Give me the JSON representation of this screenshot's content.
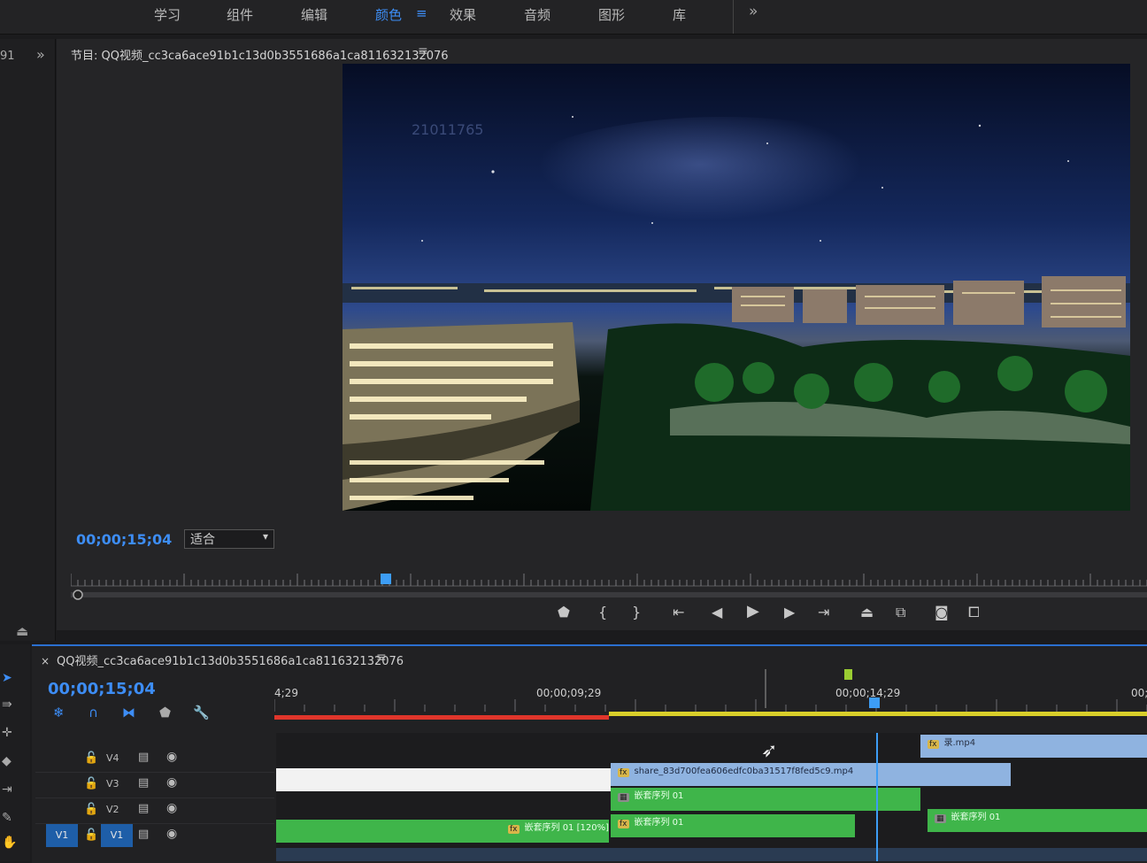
{
  "workspaces": {
    "items": [
      "学习",
      "组件",
      "编辑",
      "颜色",
      "效果",
      "音频",
      "图形",
      "库"
    ],
    "active_index": 3,
    "more": "»"
  },
  "left_panel": {
    "text": "91",
    "more": "»"
  },
  "program_monitor": {
    "title": "节目: QQ视频_cc3ca6ace91b1c13d0b3551686a1ca811632132076",
    "timecode": "00;00;15;04",
    "zoom_select": "适合",
    "frame_overlay_text": "21011765"
  },
  "transport": {
    "icons": [
      "marker-icon",
      "mark-in-icon",
      "mark-out-icon",
      "go-to-in-icon",
      "step-back-icon",
      "play-icon",
      "step-forward-icon",
      "go-to-out-icon",
      "lift-icon",
      "extract-icon",
      "export-frame-icon",
      "compare-icon"
    ]
  },
  "timeline": {
    "sequence_title": "QQ视频_cc3ca6ace91b1c13d0b3551686a1ca811632132076",
    "timecode": "00;00;15;04",
    "ruler_labels": [
      "4;29",
      "00;00;09;29",
      "00;00;14;29",
      "00;"
    ],
    "tracks": [
      {
        "name": "V4",
        "highlighted": false
      },
      {
        "name": "V3",
        "highlighted": false
      },
      {
        "name": "V2",
        "highlighted": false
      },
      {
        "name": "V1",
        "highlighted": true,
        "source": "V1"
      }
    ],
    "clips": {
      "v4": "录.mp4",
      "v3": "share_83d700fea606edfc0ba31517f8fed5c9.mp4",
      "v2": "嵌套序列 01",
      "v1a": "嵌套序列 01 [120%]",
      "v1b": "嵌套序列 01",
      "v1c": "嵌套序列 01"
    }
  },
  "colors": {
    "accent": "#3d8df5",
    "clip_green": "#3fb54a",
    "clip_blue": "#8fb3e0",
    "render_red": "#e0352b",
    "render_yellow": "#d9cf2a"
  }
}
